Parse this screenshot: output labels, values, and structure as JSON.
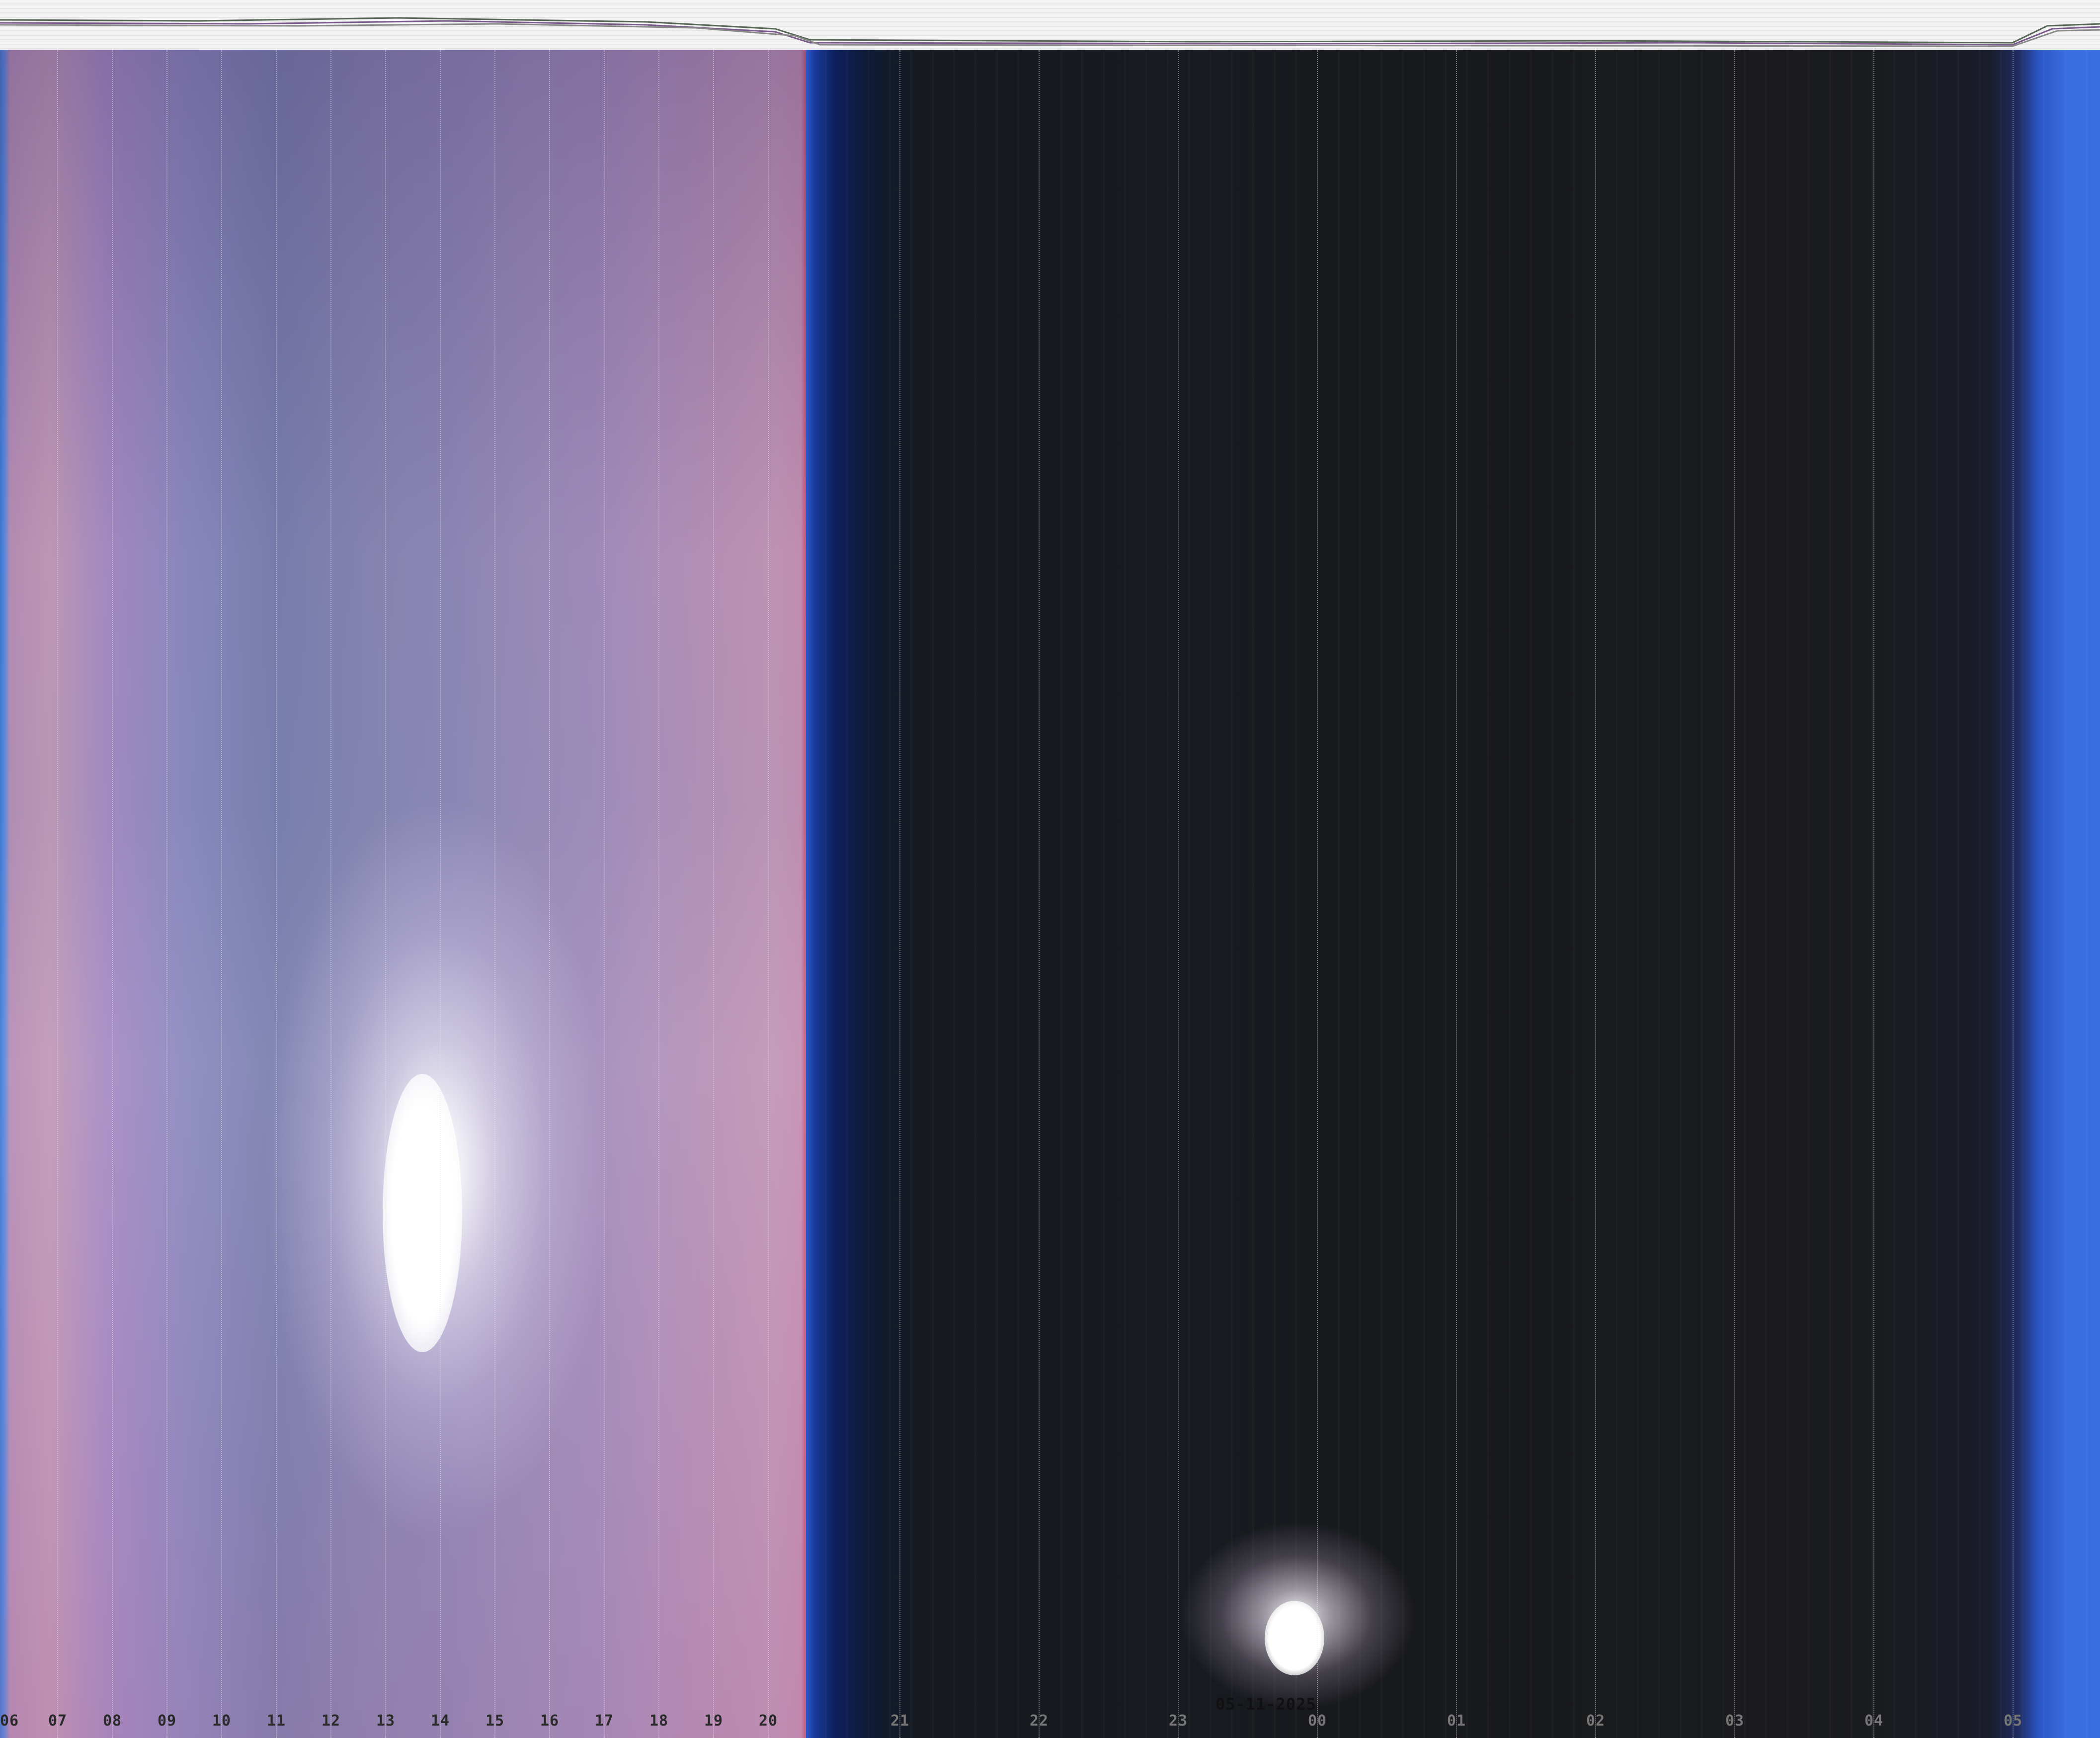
{
  "date_label": "05-11-2025",
  "hour_labels": [
    "06",
    "07",
    "08",
    "09",
    "10",
    "11",
    "12",
    "13",
    "14",
    "15",
    "16",
    "17",
    "18",
    "19",
    "20",
    "21",
    "22",
    "23",
    "00",
    "01",
    "02",
    "03",
    "04",
    "05"
  ],
  "colors": {
    "day_sky": "#a78cc4",
    "night_sky": "#18191c",
    "twilight_blue": "#3a6ee0",
    "sun": "#ffffff",
    "moon": "#ffffff",
    "sensor_strip_bg": "#f4f4f4"
  },
  "legend": {}
}
